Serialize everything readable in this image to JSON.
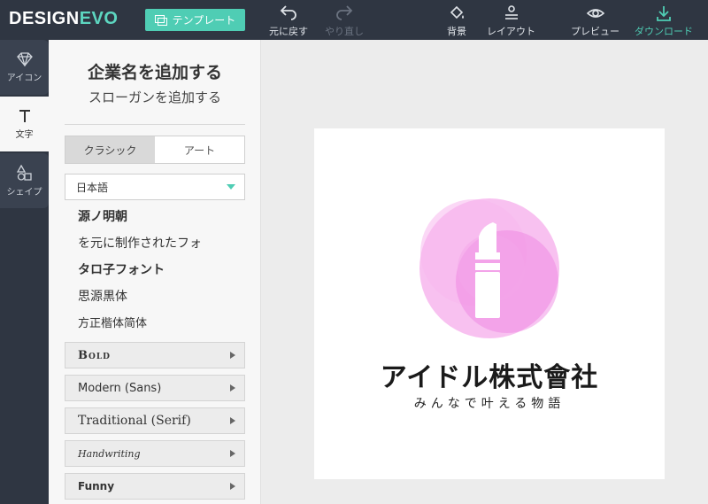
{
  "app": {
    "logo_main": "DESIGN",
    "logo_accent": "EVO"
  },
  "toolbar": {
    "template": "テンプレート",
    "undo": "元に戻す",
    "redo": "やり直し",
    "background": "背景",
    "layout": "レイアウト",
    "preview": "プレビュー",
    "download": "ダウンロード"
  },
  "nav": {
    "icon": "アイコン",
    "text": "文字",
    "shape": "シェイプ"
  },
  "panel": {
    "company": "企業名を追加する",
    "slogan": "スローガンを追加する",
    "tabs": [
      "クラシック",
      "アート"
    ],
    "language": "日本語",
    "fonts": [
      "源ノ明朝",
      "を元に制作されたフォ",
      "タロ子フォント",
      "思源黒体",
      "方正楷体简体"
    ],
    "categories": [
      "Bold",
      "Modern (Sans)",
      "Traditional (Serif)",
      "Handwriting",
      "Funny"
    ]
  },
  "canvas": {
    "brand": "アイドル株式會社",
    "tagline": "みんなで叶える物語",
    "circle_color": "#f28ee3",
    "accent": "#4fcdb4"
  }
}
